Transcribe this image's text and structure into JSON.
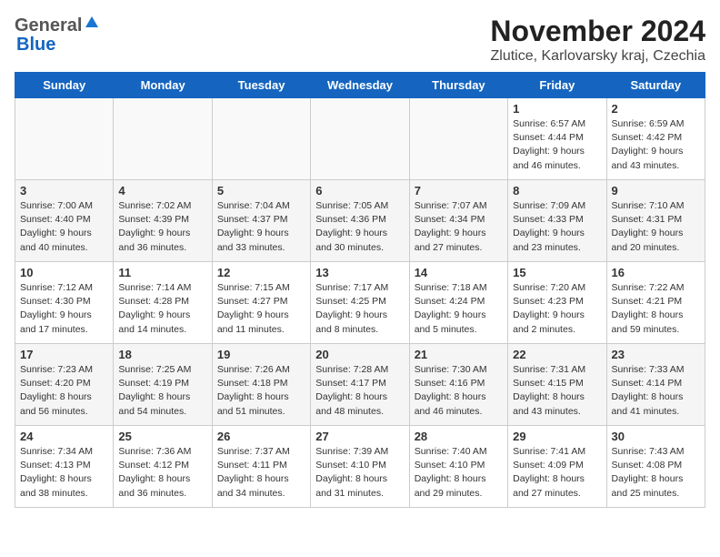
{
  "header": {
    "logo_general": "General",
    "logo_blue": "Blue",
    "month": "November 2024",
    "location": "Zlutice, Karlovarsky kraj, Czechia"
  },
  "days_of_week": [
    "Sunday",
    "Monday",
    "Tuesday",
    "Wednesday",
    "Thursday",
    "Friday",
    "Saturday"
  ],
  "weeks": [
    [
      {
        "day": "",
        "info": ""
      },
      {
        "day": "",
        "info": ""
      },
      {
        "day": "",
        "info": ""
      },
      {
        "day": "",
        "info": ""
      },
      {
        "day": "",
        "info": ""
      },
      {
        "day": "1",
        "info": "Sunrise: 6:57 AM\nSunset: 4:44 PM\nDaylight: 9 hours and 46 minutes."
      },
      {
        "day": "2",
        "info": "Sunrise: 6:59 AM\nSunset: 4:42 PM\nDaylight: 9 hours and 43 minutes."
      }
    ],
    [
      {
        "day": "3",
        "info": "Sunrise: 7:00 AM\nSunset: 4:40 PM\nDaylight: 9 hours and 40 minutes."
      },
      {
        "day": "4",
        "info": "Sunrise: 7:02 AM\nSunset: 4:39 PM\nDaylight: 9 hours and 36 minutes."
      },
      {
        "day": "5",
        "info": "Sunrise: 7:04 AM\nSunset: 4:37 PM\nDaylight: 9 hours and 33 minutes."
      },
      {
        "day": "6",
        "info": "Sunrise: 7:05 AM\nSunset: 4:36 PM\nDaylight: 9 hours and 30 minutes."
      },
      {
        "day": "7",
        "info": "Sunrise: 7:07 AM\nSunset: 4:34 PM\nDaylight: 9 hours and 27 minutes."
      },
      {
        "day": "8",
        "info": "Sunrise: 7:09 AM\nSunset: 4:33 PM\nDaylight: 9 hours and 23 minutes."
      },
      {
        "day": "9",
        "info": "Sunrise: 7:10 AM\nSunset: 4:31 PM\nDaylight: 9 hours and 20 minutes."
      }
    ],
    [
      {
        "day": "10",
        "info": "Sunrise: 7:12 AM\nSunset: 4:30 PM\nDaylight: 9 hours and 17 minutes."
      },
      {
        "day": "11",
        "info": "Sunrise: 7:14 AM\nSunset: 4:28 PM\nDaylight: 9 hours and 14 minutes."
      },
      {
        "day": "12",
        "info": "Sunrise: 7:15 AM\nSunset: 4:27 PM\nDaylight: 9 hours and 11 minutes."
      },
      {
        "day": "13",
        "info": "Sunrise: 7:17 AM\nSunset: 4:25 PM\nDaylight: 9 hours and 8 minutes."
      },
      {
        "day": "14",
        "info": "Sunrise: 7:18 AM\nSunset: 4:24 PM\nDaylight: 9 hours and 5 minutes."
      },
      {
        "day": "15",
        "info": "Sunrise: 7:20 AM\nSunset: 4:23 PM\nDaylight: 9 hours and 2 minutes."
      },
      {
        "day": "16",
        "info": "Sunrise: 7:22 AM\nSunset: 4:21 PM\nDaylight: 8 hours and 59 minutes."
      }
    ],
    [
      {
        "day": "17",
        "info": "Sunrise: 7:23 AM\nSunset: 4:20 PM\nDaylight: 8 hours and 56 minutes."
      },
      {
        "day": "18",
        "info": "Sunrise: 7:25 AM\nSunset: 4:19 PM\nDaylight: 8 hours and 54 minutes."
      },
      {
        "day": "19",
        "info": "Sunrise: 7:26 AM\nSunset: 4:18 PM\nDaylight: 8 hours and 51 minutes."
      },
      {
        "day": "20",
        "info": "Sunrise: 7:28 AM\nSunset: 4:17 PM\nDaylight: 8 hours and 48 minutes."
      },
      {
        "day": "21",
        "info": "Sunrise: 7:30 AM\nSunset: 4:16 PM\nDaylight: 8 hours and 46 minutes."
      },
      {
        "day": "22",
        "info": "Sunrise: 7:31 AM\nSunset: 4:15 PM\nDaylight: 8 hours and 43 minutes."
      },
      {
        "day": "23",
        "info": "Sunrise: 7:33 AM\nSunset: 4:14 PM\nDaylight: 8 hours and 41 minutes."
      }
    ],
    [
      {
        "day": "24",
        "info": "Sunrise: 7:34 AM\nSunset: 4:13 PM\nDaylight: 8 hours and 38 minutes."
      },
      {
        "day": "25",
        "info": "Sunrise: 7:36 AM\nSunset: 4:12 PM\nDaylight: 8 hours and 36 minutes."
      },
      {
        "day": "26",
        "info": "Sunrise: 7:37 AM\nSunset: 4:11 PM\nDaylight: 8 hours and 34 minutes."
      },
      {
        "day": "27",
        "info": "Sunrise: 7:39 AM\nSunset: 4:10 PM\nDaylight: 8 hours and 31 minutes."
      },
      {
        "day": "28",
        "info": "Sunrise: 7:40 AM\nSunset: 4:10 PM\nDaylight: 8 hours and 29 minutes."
      },
      {
        "day": "29",
        "info": "Sunrise: 7:41 AM\nSunset: 4:09 PM\nDaylight: 8 hours and 27 minutes."
      },
      {
        "day": "30",
        "info": "Sunrise: 7:43 AM\nSunset: 4:08 PM\nDaylight: 8 hours and 25 minutes."
      }
    ]
  ]
}
